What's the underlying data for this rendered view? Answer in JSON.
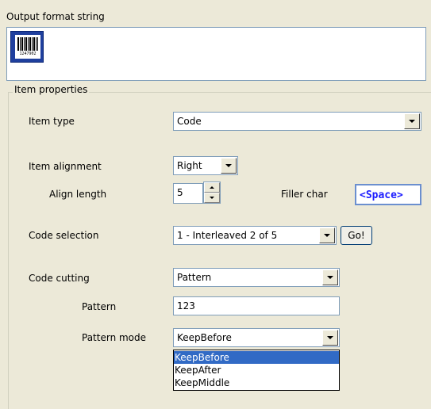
{
  "output_section": {
    "title": "Output format string",
    "barcode_digits": "1247902"
  },
  "item_properties": {
    "title": "Item properties",
    "item_type": {
      "label": "Item type",
      "value": "Code"
    },
    "item_alignment": {
      "label": "Item alignment",
      "value": "Right"
    },
    "align_length": {
      "label": "Align length",
      "value": "5"
    },
    "filler_char": {
      "label": "Filler char",
      "value": "<Space>"
    },
    "code_selection": {
      "label": "Code selection",
      "value": "1 - Interleaved 2 of 5",
      "go_label": "Go!"
    },
    "code_cutting": {
      "label": "Code cutting",
      "value": "Pattern"
    },
    "pattern": {
      "label": "Pattern",
      "value": "123"
    },
    "pattern_mode": {
      "label": "Pattern mode",
      "value": "KeepBefore",
      "options": [
        "KeepBefore",
        "KeepAfter",
        "KeepMiddle"
      ]
    }
  },
  "colors": {
    "selection": "#316ac5",
    "filler_text": "#1c1cff"
  }
}
